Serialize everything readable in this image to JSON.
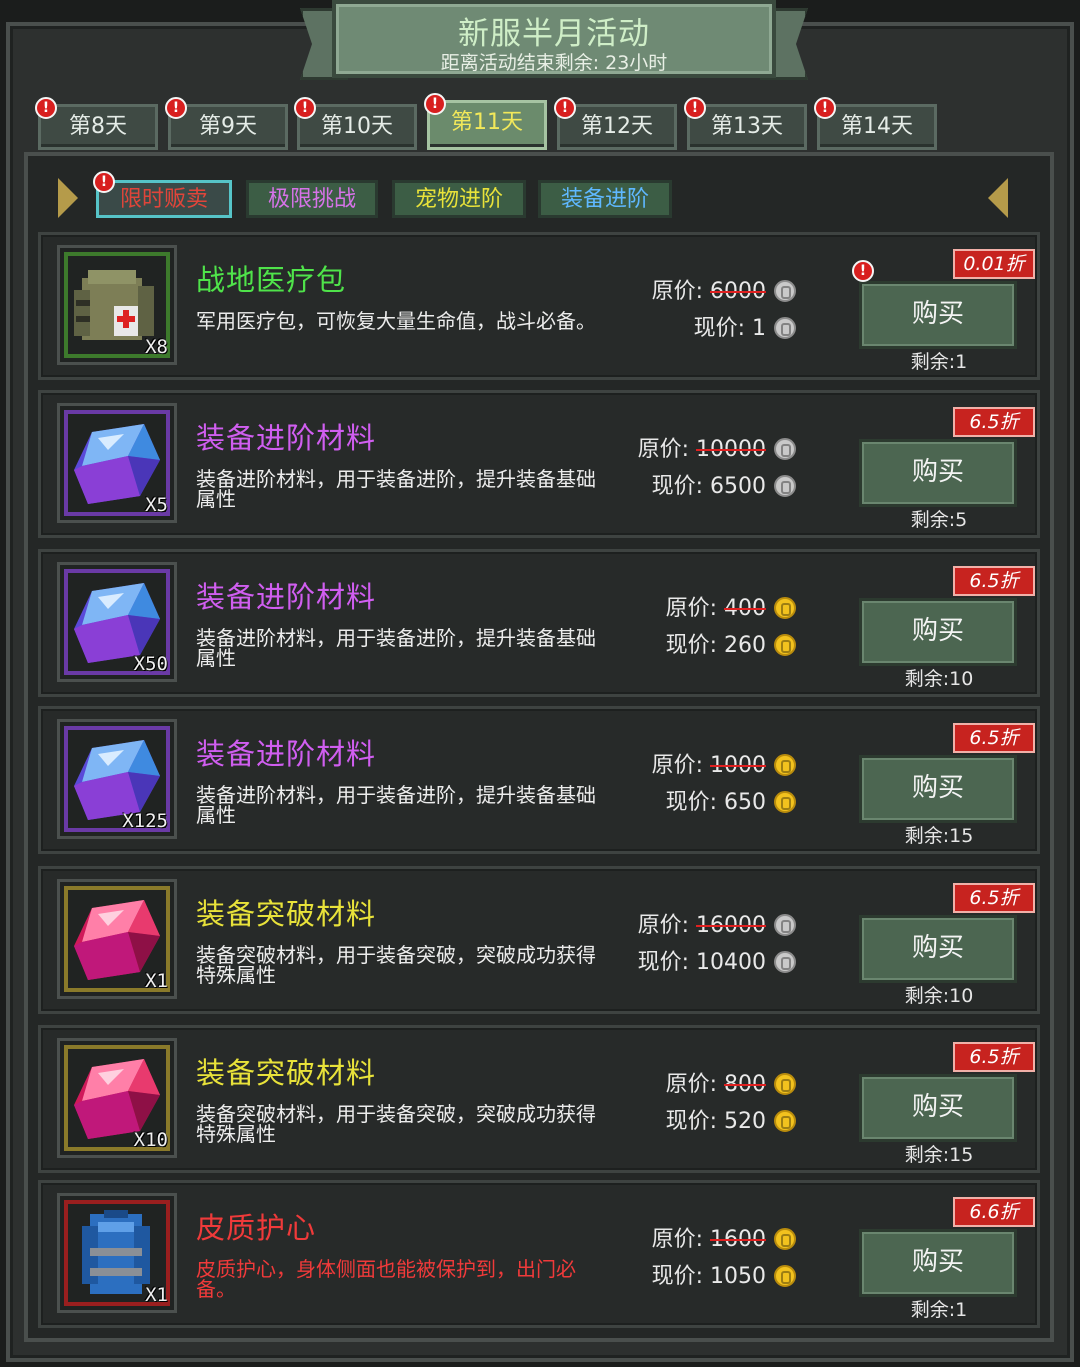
{
  "banner": {
    "title": "新服半月活动",
    "subtitle": "距离活动结束剩余: 23小时"
  },
  "day_tabs": [
    {
      "label": "第8天",
      "alert": true
    },
    {
      "label": "第9天",
      "alert": true
    },
    {
      "label": "第10天",
      "alert": true
    },
    {
      "label": "第11天",
      "alert": true,
      "active": true
    },
    {
      "label": "第12天",
      "alert": true
    },
    {
      "label": "第13天",
      "alert": true
    },
    {
      "label": "第14天",
      "alert": true
    }
  ],
  "categories": [
    {
      "label": "限时贩卖",
      "color": "#e0453a",
      "active": true,
      "alert": true
    },
    {
      "label": "极限挑战",
      "color": "#d673e8"
    },
    {
      "label": "宠物进阶",
      "color": "#e8e23a"
    },
    {
      "label": "装备进阶",
      "color": "#5fb8ff"
    }
  ],
  "alert_glyph": "!",
  "buy_label": "购买",
  "orig_label": "原价:",
  "now_label": "现价:",
  "items": [
    {
      "name": "战地医疗包",
      "name_color": "#4fe34a",
      "desc": "军用医疗包，可恢复大量生命值，战斗必备。",
      "qty": "X8",
      "icon": "medkit-icon",
      "frame_color": "#3d7a2c",
      "orig_price": "6000",
      "now_price": "1",
      "currency": "silver",
      "discount": "0.01折",
      "remain": "剩余:1",
      "alert": true
    },
    {
      "name": "装备进阶材料",
      "name_color": "#d05ef0",
      "desc": "装备进阶材料，用于装备进阶，提升装备基础属性",
      "qty": "X5",
      "icon": "blue-crystal-icon",
      "frame_color": "#6a3aa6",
      "orig_price": "10000",
      "now_price": "6500",
      "currency": "silver",
      "discount": "6.5折",
      "remain": "剩余:5"
    },
    {
      "name": "装备进阶材料",
      "name_color": "#d05ef0",
      "desc": "装备进阶材料，用于装备进阶，提升装备基础属性",
      "qty": "X50",
      "icon": "blue-crystal-icon",
      "frame_color": "#6a3aa6",
      "orig_price": "400",
      "now_price": "260",
      "currency": "gold",
      "discount": "6.5折",
      "remain": "剩余:10"
    },
    {
      "name": "装备进阶材料",
      "name_color": "#d05ef0",
      "desc": "装备进阶材料，用于装备进阶，提升装备基础属性",
      "qty": "X125",
      "icon": "blue-crystal-icon",
      "frame_color": "#6a3aa6",
      "orig_price": "1000",
      "now_price": "650",
      "currency": "gold",
      "discount": "6.5折",
      "remain": "剩余:15"
    },
    {
      "name": "装备突破材料",
      "name_color": "#e8e23a",
      "desc": "装备突破材料，用于装备突破，突破成功获得特殊属性",
      "qty": "X1",
      "icon": "pink-crystal-icon",
      "frame_color": "#8a7a2a",
      "orig_price": "16000",
      "now_price": "10400",
      "currency": "silver",
      "discount": "6.5折",
      "remain": "剩余:10"
    },
    {
      "name": "装备突破材料",
      "name_color": "#e8e23a",
      "desc": "装备突破材料，用于装备突破，突破成功获得特殊属性",
      "qty": "X10",
      "icon": "pink-crystal-icon",
      "frame_color": "#8a7a2a",
      "orig_price": "800",
      "now_price": "520",
      "currency": "gold",
      "discount": "6.5折",
      "remain": "剩余:15"
    },
    {
      "name": "皮质护心",
      "name_color": "#f03a3a",
      "desc": "皮质护心，身体侧面也能被保护到，出门必备。",
      "desc_color": "#f03a3a",
      "qty": "X1",
      "icon": "vest-icon",
      "frame_color": "#9a1f1f",
      "orig_price": "1600",
      "now_price": "1050",
      "currency": "gold",
      "discount": "6.6折",
      "remain": "剩余:1"
    }
  ]
}
